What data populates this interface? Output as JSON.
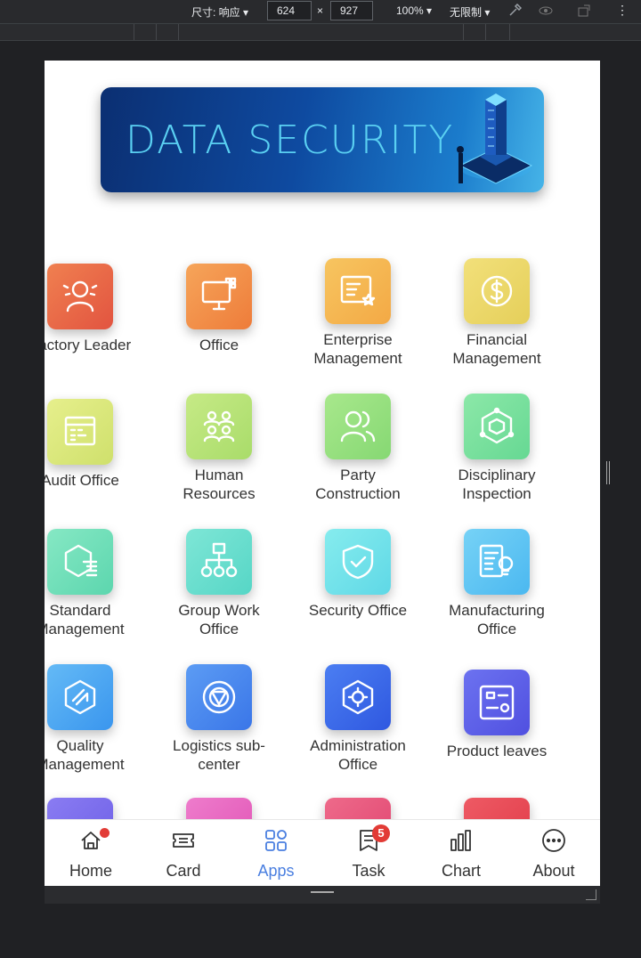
{
  "devtools": {
    "size_label": "尺寸: 响应",
    "width": "624",
    "times": "×",
    "height": "927",
    "zoom": "100%",
    "throttle": "无限制"
  },
  "banner": {
    "title": "DATA  SECURITY"
  },
  "apps": [
    {
      "label": "Factory Leader",
      "icon": "person-icon",
      "color": [
        "#f08050",
        "#e25440"
      ]
    },
    {
      "label": "Office",
      "icon": "monitor-icon",
      "color": [
        "#f6a55a",
        "#ee7c3a"
      ]
    },
    {
      "label": "Enterprise Management",
      "icon": "certificate-icon",
      "color": [
        "#f7c560",
        "#f3a945"
      ]
    },
    {
      "label": "Financial Management",
      "icon": "dollar-coin-icon",
      "color": [
        "#f2e07a",
        "#e5cf5a"
      ]
    },
    {
      "label": "Audit Office",
      "icon": "calculator-icon",
      "color": [
        "#e6ef8c",
        "#cfe06c"
      ]
    },
    {
      "label": "Human Resources",
      "icon": "people-group-icon",
      "color": [
        "#c6ea86",
        "#a9dc6a"
      ]
    },
    {
      "label": "Party Construction",
      "icon": "two-people-icon",
      "color": [
        "#a8e88c",
        "#86d873"
      ]
    },
    {
      "label": "Disciplinary Inspection",
      "icon": "hexagon-network-icon",
      "color": [
        "#8ce8a8",
        "#66d893"
      ]
    },
    {
      "label": "Standard Management",
      "icon": "hexagon-list-icon",
      "color": [
        "#86e8c4",
        "#5cd6ae"
      ]
    },
    {
      "label": "Group Work Office",
      "icon": "org-chart-icon",
      "color": [
        "#7ee6d6",
        "#56d6c6"
      ]
    },
    {
      "label": "Security Office",
      "icon": "shield-check-icon",
      "color": [
        "#86ecee",
        "#5fd8e6"
      ]
    },
    {
      "label": "Manufacturing Office",
      "icon": "document-bulb-icon",
      "color": [
        "#76d2f6",
        "#4bb8f0"
      ]
    },
    {
      "label": "Quality Management",
      "icon": "hexagon-box-icon",
      "color": [
        "#64baf6",
        "#3a96ee"
      ]
    },
    {
      "label": "Logistics sub-center",
      "icon": "target-circle-icon",
      "color": [
        "#5c9cf4",
        "#3a76e8"
      ]
    },
    {
      "label": "Administration Office",
      "icon": "hexagon-cog-icon",
      "color": [
        "#4b7ef2",
        "#2f58e0"
      ]
    },
    {
      "label": "Product leaves",
      "icon": "product-card-icon",
      "color": [
        "#6c72f0",
        "#5050e0"
      ]
    }
  ],
  "partial_row_colors": [
    [
      "#8a7cf2",
      "#6c5ee6"
    ],
    [
      "#ee7ccc",
      "#e052b4"
    ],
    [
      "#ee6a8a",
      "#e04470"
    ],
    [
      "#ee5a64",
      "#e03a48"
    ]
  ],
  "tabbar": [
    {
      "label": "Home",
      "icon": "home-icon",
      "active": false
    },
    {
      "label": "Card",
      "icon": "ticket-icon",
      "active": false
    },
    {
      "label": "Apps",
      "icon": "grid-apps-icon",
      "active": true
    },
    {
      "label": "Task",
      "icon": "task-flag-icon",
      "active": false,
      "badge": "5"
    },
    {
      "label": "Chart",
      "icon": "bar-chart-icon",
      "active": false
    },
    {
      "label": "About",
      "icon": "more-dots-icon",
      "active": false
    }
  ]
}
